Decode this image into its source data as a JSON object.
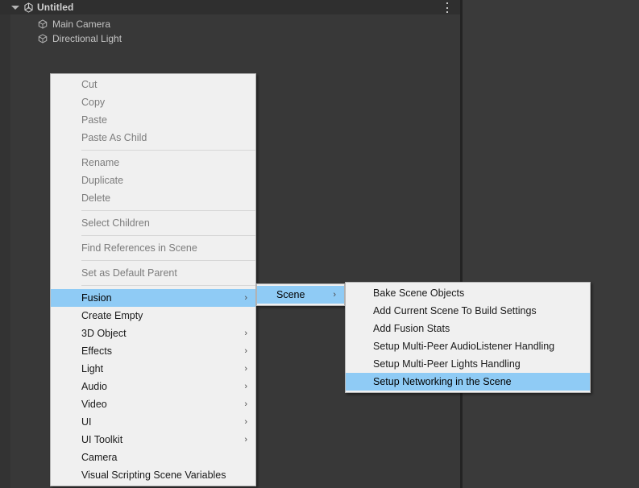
{
  "window": {
    "title": "Untitled",
    "scene_icon": "unity-scene-icon",
    "options_icon": "kebab-menu-icon"
  },
  "hierarchy": {
    "objects": [
      {
        "label": "Main Camera",
        "icon": "gameobject-cube-icon"
      },
      {
        "label": "Directional Light",
        "icon": "gameobject-cube-icon"
      }
    ]
  },
  "colors": {
    "editor_background": "#383838",
    "header_background": "#2f2f2f",
    "menu_background": "#f0f0f0",
    "highlight_blue": "#8FCBF5",
    "menu_text": "#1a1a1a",
    "menu_text_disabled": "#7c7c7c",
    "hierarchy_text": "#c4c4c4"
  },
  "context_menu": {
    "groups": [
      {
        "items": [
          {
            "label": "Cut",
            "disabled": true,
            "submenu": false,
            "highlighted": false
          },
          {
            "label": "Copy",
            "disabled": true,
            "submenu": false,
            "highlighted": false
          },
          {
            "label": "Paste",
            "disabled": true,
            "submenu": false,
            "highlighted": false
          },
          {
            "label": "Paste As Child",
            "disabled": true,
            "submenu": false,
            "highlighted": false
          }
        ]
      },
      {
        "items": [
          {
            "label": "Rename",
            "disabled": true,
            "submenu": false,
            "highlighted": false
          },
          {
            "label": "Duplicate",
            "disabled": true,
            "submenu": false,
            "highlighted": false
          },
          {
            "label": "Delete",
            "disabled": true,
            "submenu": false,
            "highlighted": false
          }
        ]
      },
      {
        "items": [
          {
            "label": "Select Children",
            "disabled": true,
            "submenu": false,
            "highlighted": false
          }
        ]
      },
      {
        "items": [
          {
            "label": "Find References in Scene",
            "disabled": true,
            "submenu": false,
            "highlighted": false
          }
        ]
      },
      {
        "items": [
          {
            "label": "Set as Default Parent",
            "disabled": true,
            "submenu": false,
            "highlighted": false
          }
        ]
      },
      {
        "items": [
          {
            "label": "Fusion",
            "disabled": false,
            "submenu": true,
            "highlighted": true
          },
          {
            "label": "Create Empty",
            "disabled": false,
            "submenu": false,
            "highlighted": false
          },
          {
            "label": "3D Object",
            "disabled": false,
            "submenu": true,
            "highlighted": false
          },
          {
            "label": "Effects",
            "disabled": false,
            "submenu": true,
            "highlighted": false
          },
          {
            "label": "Light",
            "disabled": false,
            "submenu": true,
            "highlighted": false
          },
          {
            "label": "Audio",
            "disabled": false,
            "submenu": true,
            "highlighted": false
          },
          {
            "label": "Video",
            "disabled": false,
            "submenu": true,
            "highlighted": false
          },
          {
            "label": "UI",
            "disabled": false,
            "submenu": true,
            "highlighted": false
          },
          {
            "label": "UI Toolkit",
            "disabled": false,
            "submenu": true,
            "highlighted": false
          },
          {
            "label": "Camera",
            "disabled": false,
            "submenu": false,
            "highlighted": false
          },
          {
            "label": "Visual Scripting Scene Variables",
            "disabled": false,
            "submenu": false,
            "highlighted": false
          }
        ]
      }
    ]
  },
  "submenu_fusion": {
    "items": [
      {
        "label": "Scene",
        "disabled": false,
        "submenu": true,
        "highlighted": true
      }
    ]
  },
  "submenu_scene": {
    "items": [
      {
        "label": "Bake Scene Objects",
        "disabled": false,
        "submenu": false,
        "highlighted": false
      },
      {
        "label": "Add Current Scene To Build Settings",
        "disabled": false,
        "submenu": false,
        "highlighted": false
      },
      {
        "label": "Add Fusion Stats",
        "disabled": false,
        "submenu": false,
        "highlighted": false
      },
      {
        "label": "Setup Multi-Peer AudioListener Handling",
        "disabled": false,
        "submenu": false,
        "highlighted": false
      },
      {
        "label": "Setup Multi-Peer Lights Handling",
        "disabled": false,
        "submenu": false,
        "highlighted": false
      },
      {
        "label": "Setup Networking in the Scene",
        "disabled": false,
        "submenu": false,
        "highlighted": true
      }
    ]
  }
}
